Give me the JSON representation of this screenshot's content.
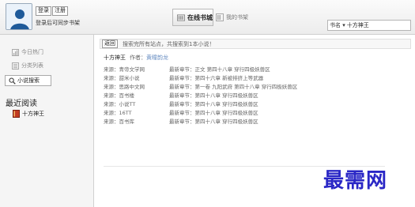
{
  "header": {
    "login_label": "登录",
    "register_label": "注册",
    "sync_text": "登录后可同步书架",
    "tabs": [
      {
        "label": "在线书城",
        "active": true
      },
      {
        "label": "我的书架",
        "active": false
      }
    ],
    "search": {
      "type": "书名",
      "value": "十方神王"
    }
  },
  "sidebar": {
    "items": [
      {
        "label": "今日热门",
        "icon": "chart-icon"
      },
      {
        "label": "分类列表",
        "icon": "list-icon"
      },
      {
        "label": "小说搜索",
        "icon": "search-icon"
      }
    ],
    "recent_title": "最近阅读",
    "recent_items": [
      {
        "label": "十方神王",
        "icon": "book-icon"
      }
    ]
  },
  "main": {
    "back_label": "返回",
    "info_message": "搜索完所有站点，共搜索到1本小说！",
    "book": {
      "title": "十方神王",
      "author_label": "作者：",
      "author": "黄瞳韵龙"
    },
    "sources": [
      {
        "source": "来源：青帝文学网",
        "chapter": "最新章节：正文 第四十八章 穿行四极妖兽区"
      },
      {
        "source": "来源：甜米小说",
        "chapter": "最新章节：第四十六章 新被排挤上等武器"
      },
      {
        "source": "来源：思路中文网",
        "chapter": "最新章节：第一卷 九阳武府 第四十八章 穿行四极妖兽区"
      },
      {
        "source": "来源：百书楼",
        "chapter": "最新章节：第四十八章 穿行四极妖兽区"
      },
      {
        "source": "来源：小说TT",
        "chapter": "最新章节：第四十八章 穿行四极妖兽区"
      },
      {
        "source": "来源：16TT",
        "chapter": "最新章节：第四十八章 穿行四极妖兽区"
      },
      {
        "source": "来源：百书库",
        "chapter": "最新章节：第四十八章 穿行四极妖兽区"
      }
    ]
  },
  "watermark": "最需网",
  "colors": {
    "author_link": "#6a8fc3",
    "watermark": "#2a27c6"
  }
}
